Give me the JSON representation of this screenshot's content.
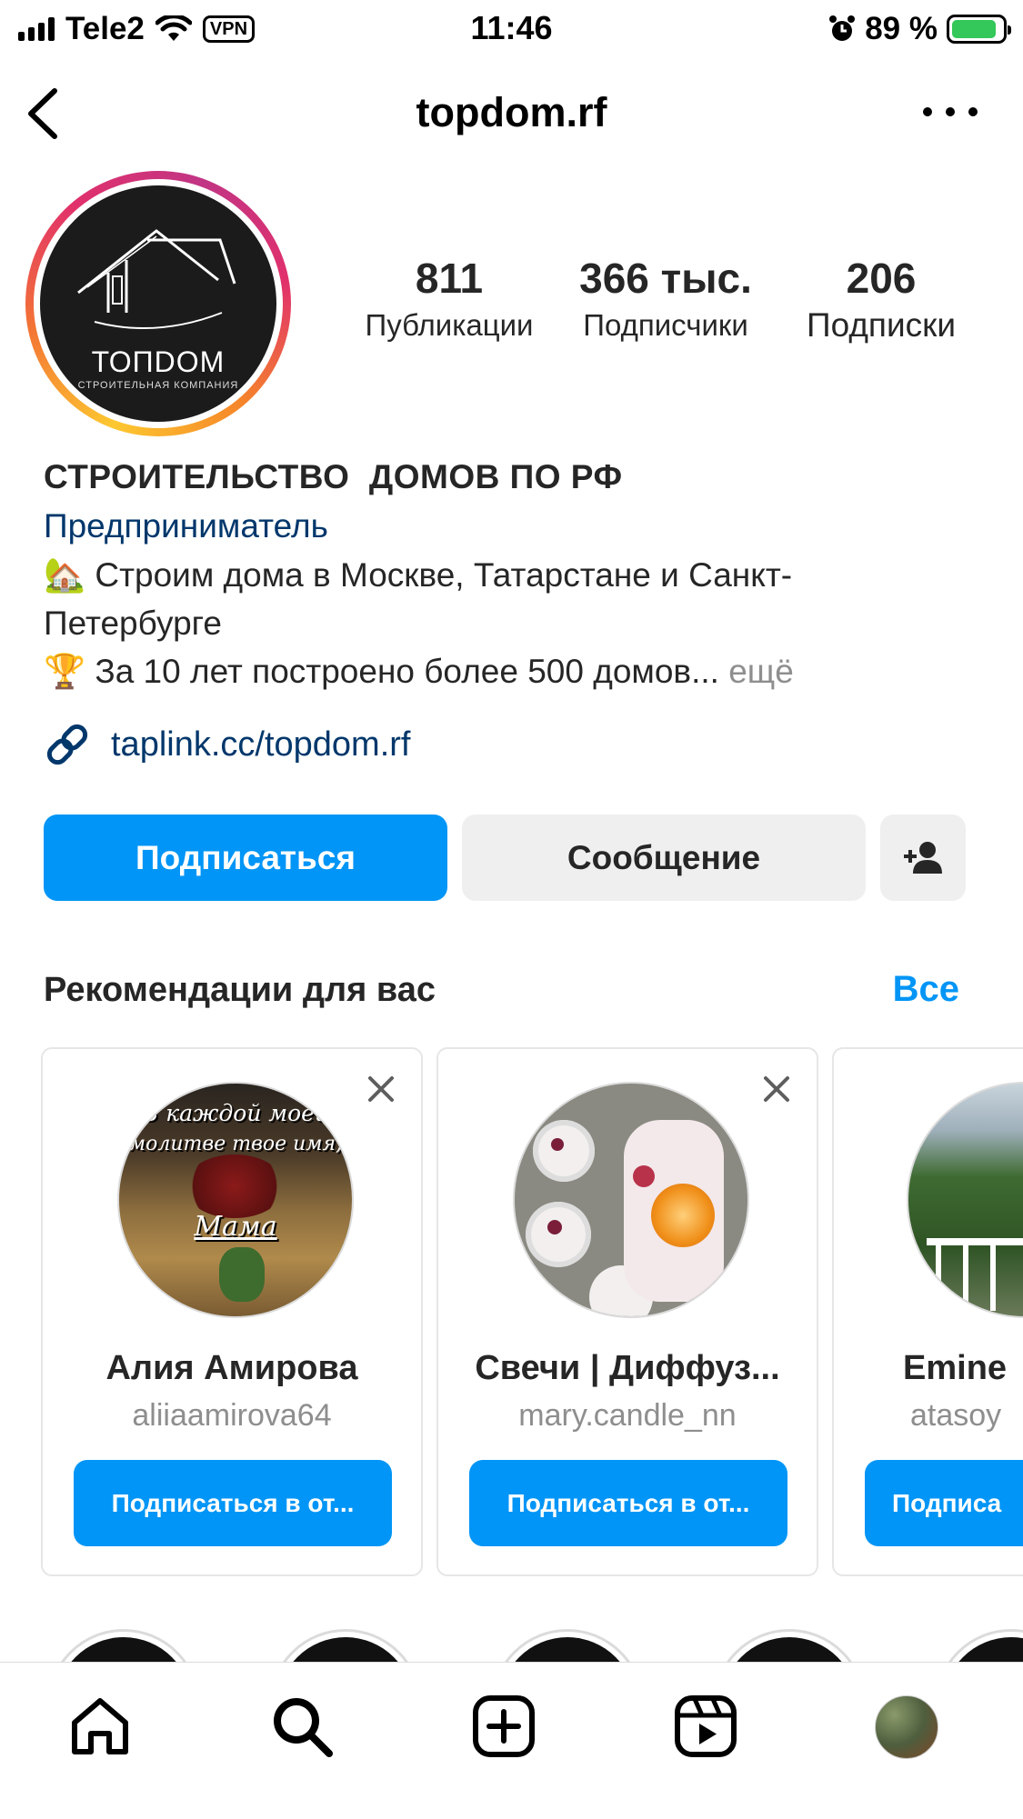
{
  "status_bar": {
    "carrier": "Tele2",
    "vpn": "VPN",
    "time": "11:46",
    "battery": "89 %",
    "battery_level": 0.89
  },
  "header": {
    "title": "topdom.rf"
  },
  "profile": {
    "avatar_logo": "ТОПDОМ",
    "avatar_logo_sub": "СТРОИТЕЛЬНАЯ КОМПАНИЯ",
    "stats": [
      {
        "value": "811",
        "label": "Публикации"
      },
      {
        "value": "366 тыс.",
        "label": "Подписчики"
      },
      {
        "value": "206",
        "label": "Подписки"
      }
    ],
    "name": "СТРОИТЕЛЬСТВО  ДОМОВ ПО РФ",
    "category": "Предприниматель",
    "bio_line1": "🏡 Строим дома в Москве, Татарстане и Санкт-",
    "bio_line2": "Петербурге",
    "bio_line3": "🏆 За 10 лет построено более 500 домов...",
    "more": "ещё",
    "link": "taplink.cc/topdom.rf"
  },
  "actions": {
    "follow": "Подписаться",
    "message": "Сообщение"
  },
  "recommendations": {
    "title": "Рекомендации для вас",
    "see_all": "Все",
    "cards": [
      {
        "name": "Алия Амирова",
        "username": "aliiaamirova64",
        "button": "Подписаться в от...",
        "avatar_text_1": "В каждой моей",
        "avatar_text_2": "молитве твое имя,",
        "avatar_text_3": "Мама"
      },
      {
        "name": "Свечи | Диффуз...",
        "username": "mary.candle_nn",
        "button": "Подписаться в от..."
      },
      {
        "name": "Emine",
        "username": "atasoy",
        "button": "Подписа"
      }
    ]
  },
  "colors": {
    "accent": "#0095f6",
    "link": "#00376b",
    "secondary_text": "#8e8e8e",
    "battery_green": "#34c759"
  }
}
